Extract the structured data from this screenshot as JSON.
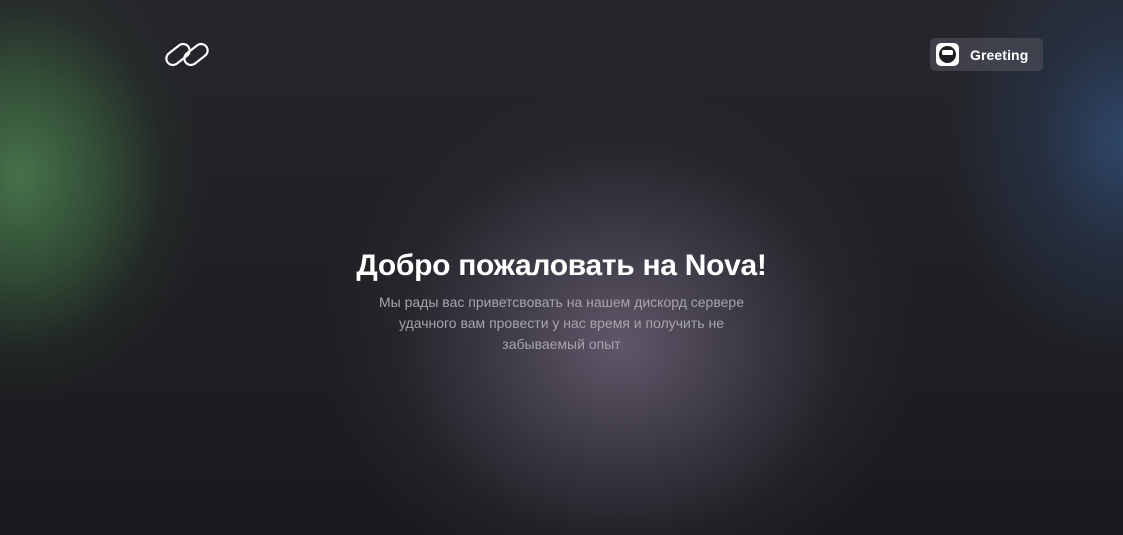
{
  "header": {
    "logo_icon": "link-icon",
    "greeting_button": {
      "label": "Greeting",
      "icon": "bot-avatar-icon"
    }
  },
  "hero": {
    "title": "Добро пожаловать на Nova!",
    "subtitle": "Мы рады вас приветсвовать на нашем дискорд сервере\nудачного вам провести  у нас время и получить не\nзабываемый опыт"
  },
  "colors": {
    "background": "#1c1c20",
    "glow_left": "#48764c",
    "glow_right": "#304a6e",
    "glow_center": "#625a6c",
    "button_bg": "#484a54",
    "title": "#ffffff",
    "subtitle": "#a6a4ac"
  }
}
